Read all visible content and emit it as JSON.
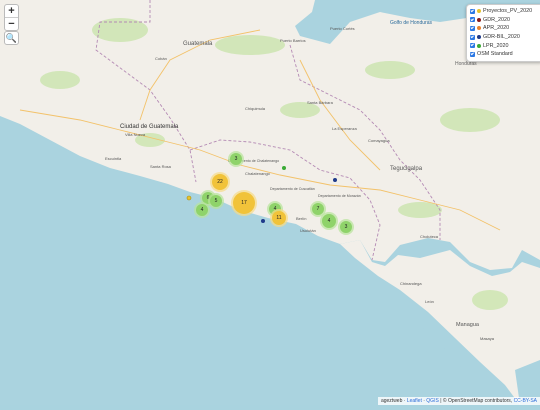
{
  "zoom": {
    "in_label": "+",
    "out_label": "−"
  },
  "search_icon": "🔍",
  "legend": {
    "items": [
      {
        "label": "Proyectos_PV_2020",
        "color": "#e6c32e",
        "checked": true
      },
      {
        "label": "GDR_2020",
        "color": "#8b1a1a",
        "checked": true
      },
      {
        "label": "APR_2020",
        "color": "#e8822e",
        "checked": true
      },
      {
        "label": "GDR-BIL_2020",
        "color": "#1f3a8a",
        "checked": true
      },
      {
        "label": "LPR_2020",
        "color": "#3aaa35",
        "checked": true
      },
      {
        "label": "OSM Standard",
        "color": "",
        "checked": true
      }
    ]
  },
  "labels": {
    "countries": [
      "Guatemala",
      "Honduras"
    ],
    "capitals": [
      "Ciudad de Guatemala",
      "Tegucigalpa",
      "Managua"
    ],
    "cities": [
      "Cobán",
      "Puerto Barrios",
      "Puerto Cortés",
      "Chiquimula",
      "Santa Rosa",
      "Escuintla",
      "Chalatenango",
      "Santa Bárbara",
      "Comayagua",
      "La Esperanza",
      "Choluteca",
      "Chinandega",
      "León",
      "Masaya",
      "Villa Nueva",
      "Departamento de Chalatenango",
      "Departamento de Cuscatlán",
      "Departamento de Morazán",
      "Usulután",
      "Berlín"
    ],
    "seas": [
      "Golfo de Honduras"
    ]
  },
  "clusters": [
    {
      "count": "3",
      "fill": "#8fd36a",
      "ring": "#b8e49a"
    },
    {
      "count": "22",
      "fill": "#f1c33a",
      "ring": "#f7dc86"
    },
    {
      "count": "6",
      "fill": "#8fd36a",
      "ring": "#b8e49a"
    },
    {
      "count": "5",
      "fill": "#8fd36a",
      "ring": "#b8e49a"
    },
    {
      "count": "4",
      "fill": "#8fd36a",
      "ring": "#b8e49a"
    },
    {
      "count": "17",
      "fill": "#f1c33a",
      "ring": "#f7dc86"
    },
    {
      "count": "4",
      "fill": "#8fd36a",
      "ring": "#b8e49a"
    },
    {
      "count": "11",
      "fill": "#f1c33a",
      "ring": "#f7dc86"
    },
    {
      "count": "7",
      "fill": "#8fd36a",
      "ring": "#b8e49a"
    },
    {
      "count": "4",
      "fill": "#8fd36a",
      "ring": "#b8e49a"
    },
    {
      "count": "3",
      "fill": "#8fd36a",
      "ring": "#b8e49a"
    }
  ],
  "attribution": {
    "text1": "ageztweb",
    "leaflet": "Leaflet",
    "qgis": "QGIS",
    "osm": "© OpenStreetMap contributors",
    "cc": "CC-BY-SA"
  }
}
